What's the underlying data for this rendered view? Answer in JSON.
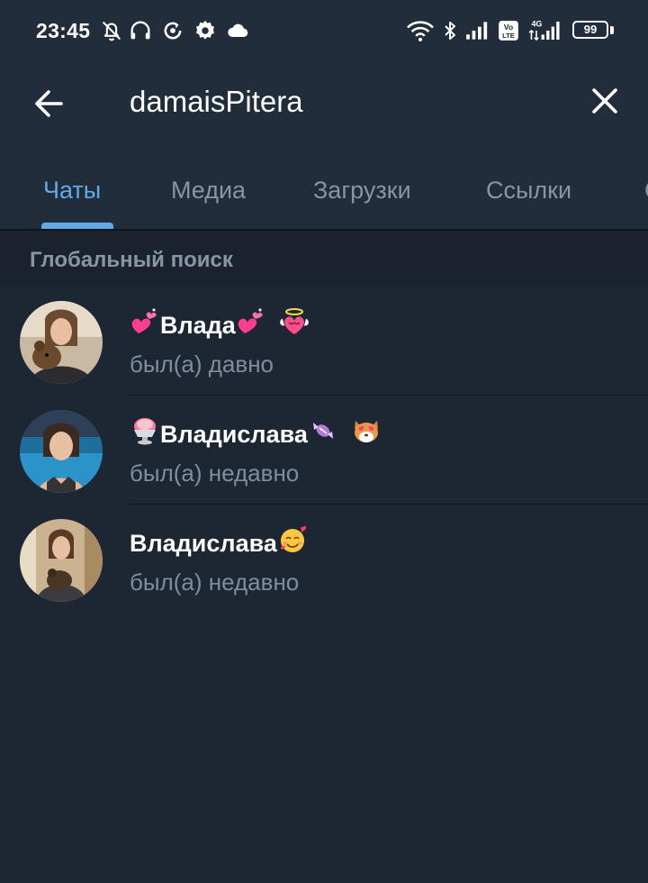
{
  "status_bar": {
    "time": "23:45",
    "battery": "99",
    "icons": [
      "bell-off-icon",
      "headset-icon",
      "sync-icon",
      "gear-icon",
      "cloud-icon",
      "wifi-icon",
      "bluetooth-icon",
      "signal-icon",
      "volte-icon",
      "signal-4g-icon",
      "battery-icon"
    ]
  },
  "search": {
    "query": "damaisPitera",
    "back_icon": "arrow-left-icon",
    "clear_icon": "close-icon"
  },
  "tabs": [
    {
      "label": "Чаты",
      "active": true
    },
    {
      "label": "Медиа",
      "active": false
    },
    {
      "label": "Загрузки",
      "active": false
    },
    {
      "label": "Ссылки",
      "active": false
    }
  ],
  "section": {
    "title": "Глобальный поиск"
  },
  "results": [
    {
      "name": "Влада",
      "status": "был(а) давно",
      "emoji_before": [
        "sparkling-hearts-emoji"
      ],
      "emoji_after": [
        "sparkling-hearts-emoji",
        "angel-heart-emoji"
      ]
    },
    {
      "name": "Владислава",
      "status": "был(а) недавно",
      "emoji_before": [
        "shaved-ice-emoji"
      ],
      "emoji_after": [
        "candy-emoji",
        "heart-eyes-dog-emoji"
      ]
    },
    {
      "name": "Владислава",
      "status": "был(а) недавно",
      "emoji_before": [],
      "emoji_after": [
        "smiling-face-with-hearts-emoji"
      ]
    }
  ],
  "colors": {
    "background": "#1d2733",
    "header": "#212d3b",
    "accent": "#63a9e6",
    "tab_inactive": "#8596a6",
    "section_bg": "#19222d",
    "secondary_text": "#7f8d9c"
  }
}
